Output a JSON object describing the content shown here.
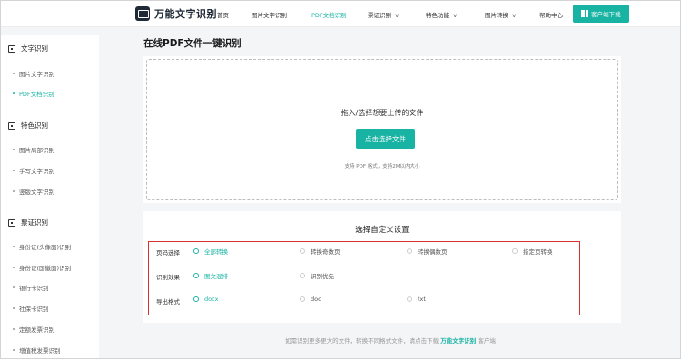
{
  "header": {
    "logo_text": "万能文字识别",
    "nav": [
      {
        "label": "首页",
        "dropdown": false,
        "active": false
      },
      {
        "label": "图片文字识别",
        "dropdown": false,
        "active": false
      },
      {
        "label": "PDF文档识别",
        "dropdown": false,
        "active": true
      },
      {
        "label": "票证识别",
        "dropdown": true,
        "active": false
      },
      {
        "label": "特色功能",
        "dropdown": true,
        "active": false
      },
      {
        "label": "图片转换",
        "dropdown": true,
        "active": false
      },
      {
        "label": "帮助中心",
        "dropdown": false,
        "active": false
      }
    ],
    "download_label": "客户端下载",
    "download_icon": "windows-icon"
  },
  "sidebar": {
    "groups": [
      {
        "title": "文字识别",
        "icon": "scan-icon",
        "items": [
          {
            "label": "图片文字识别",
            "active": false
          },
          {
            "label": "PDF文档识别",
            "active": true
          }
        ]
      },
      {
        "title": "特色识别",
        "icon": "scan-icon",
        "items": [
          {
            "label": "图片局部识别",
            "active": false
          },
          {
            "label": "手写文字识别",
            "active": false
          },
          {
            "label": "竖版文字识别",
            "active": false
          }
        ]
      },
      {
        "title": "票证识别",
        "icon": "scan-icon",
        "items": [
          {
            "label": "身份证(头像面)识别",
            "active": false
          },
          {
            "label": "身份证(国徽面)识别",
            "active": false
          },
          {
            "label": "银行卡识别",
            "active": false
          },
          {
            "label": "社保卡识别",
            "active": false
          },
          {
            "label": "定额发票识别",
            "active": false
          },
          {
            "label": "增值税发票识别",
            "active": false
          }
        ]
      }
    ]
  },
  "main": {
    "title": "在线PDF文件一键识别",
    "upload": {
      "prompt": "拖入/选择想要上传的文件",
      "button_label": "点击选择文件",
      "support_text": "支持 PDF 格式，支持2M以内大小"
    },
    "settings": {
      "title": "选择自定义设置",
      "rows": [
        {
          "label": "页码选择",
          "options": [
            {
              "label": "全部转换",
              "selected": true
            },
            {
              "label": "转换奇数页",
              "selected": false
            },
            {
              "label": "转换偶数页",
              "selected": false
            },
            {
              "label": "指定页转换",
              "selected": false
            }
          ]
        },
        {
          "label": "识别效果",
          "options": [
            {
              "label": "图文混排",
              "selected": true
            },
            {
              "label": "识别优先",
              "selected": false
            }
          ]
        },
        {
          "label": "导出格式",
          "options": [
            {
              "label": "docx",
              "selected": true
            },
            {
              "label": "doc",
              "selected": false
            },
            {
              "label": "txt",
              "selected": false
            }
          ]
        }
      ]
    },
    "footer": {
      "prefix": "如需识别更多更大的文件，转换不同格式文件，请点击下载",
      "brand": "万能文字识别",
      "suffix": "客户端"
    }
  },
  "colors": {
    "accent": "#19b3a3",
    "highlight_border": "#d93030"
  }
}
